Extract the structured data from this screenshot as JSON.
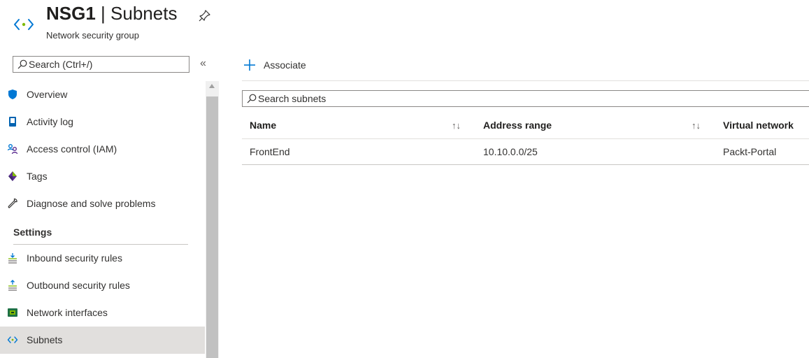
{
  "header": {
    "resource_name": "NSG1",
    "separator": "|",
    "page_name": "Subnets",
    "subtitle": "Network security group",
    "icon": "subnet-brackets-icon",
    "pin_icon": "pin-icon"
  },
  "sidebar": {
    "search_placeholder": "Search (Ctrl+/)",
    "collapse_label": "«",
    "items": [
      {
        "label": "Overview",
        "icon": "shield-icon"
      },
      {
        "label": "Activity log",
        "icon": "activity-log-icon"
      },
      {
        "label": "Access control (IAM)",
        "icon": "people-icon"
      },
      {
        "label": "Tags",
        "icon": "tag-icon"
      },
      {
        "label": "Diagnose and solve problems",
        "icon": "wrench-icon"
      }
    ],
    "settings_heading": "Settings",
    "settings_items": [
      {
        "label": "Inbound security rules",
        "icon": "inbound-rules-icon"
      },
      {
        "label": "Outbound security rules",
        "icon": "outbound-rules-icon"
      },
      {
        "label": "Network interfaces",
        "icon": "network-interface-icon"
      },
      {
        "label": "Subnets",
        "icon": "subnet-brackets-icon",
        "active": true
      }
    ]
  },
  "main": {
    "associate_label": "Associate",
    "search_placeholder": "Search subnets",
    "columns": [
      "Name",
      "Address range",
      "Virtual network"
    ],
    "sort_symbol": "↑↓",
    "rows": [
      {
        "name": "FrontEnd",
        "address_range": "10.10.0.0/25",
        "virtual_network": "Packt-Portal"
      }
    ]
  },
  "colors": {
    "accent": "#0078d4",
    "active_item_bg": "#e1dfdd",
    "scrollbar_thumb": "#c1c1c1"
  }
}
